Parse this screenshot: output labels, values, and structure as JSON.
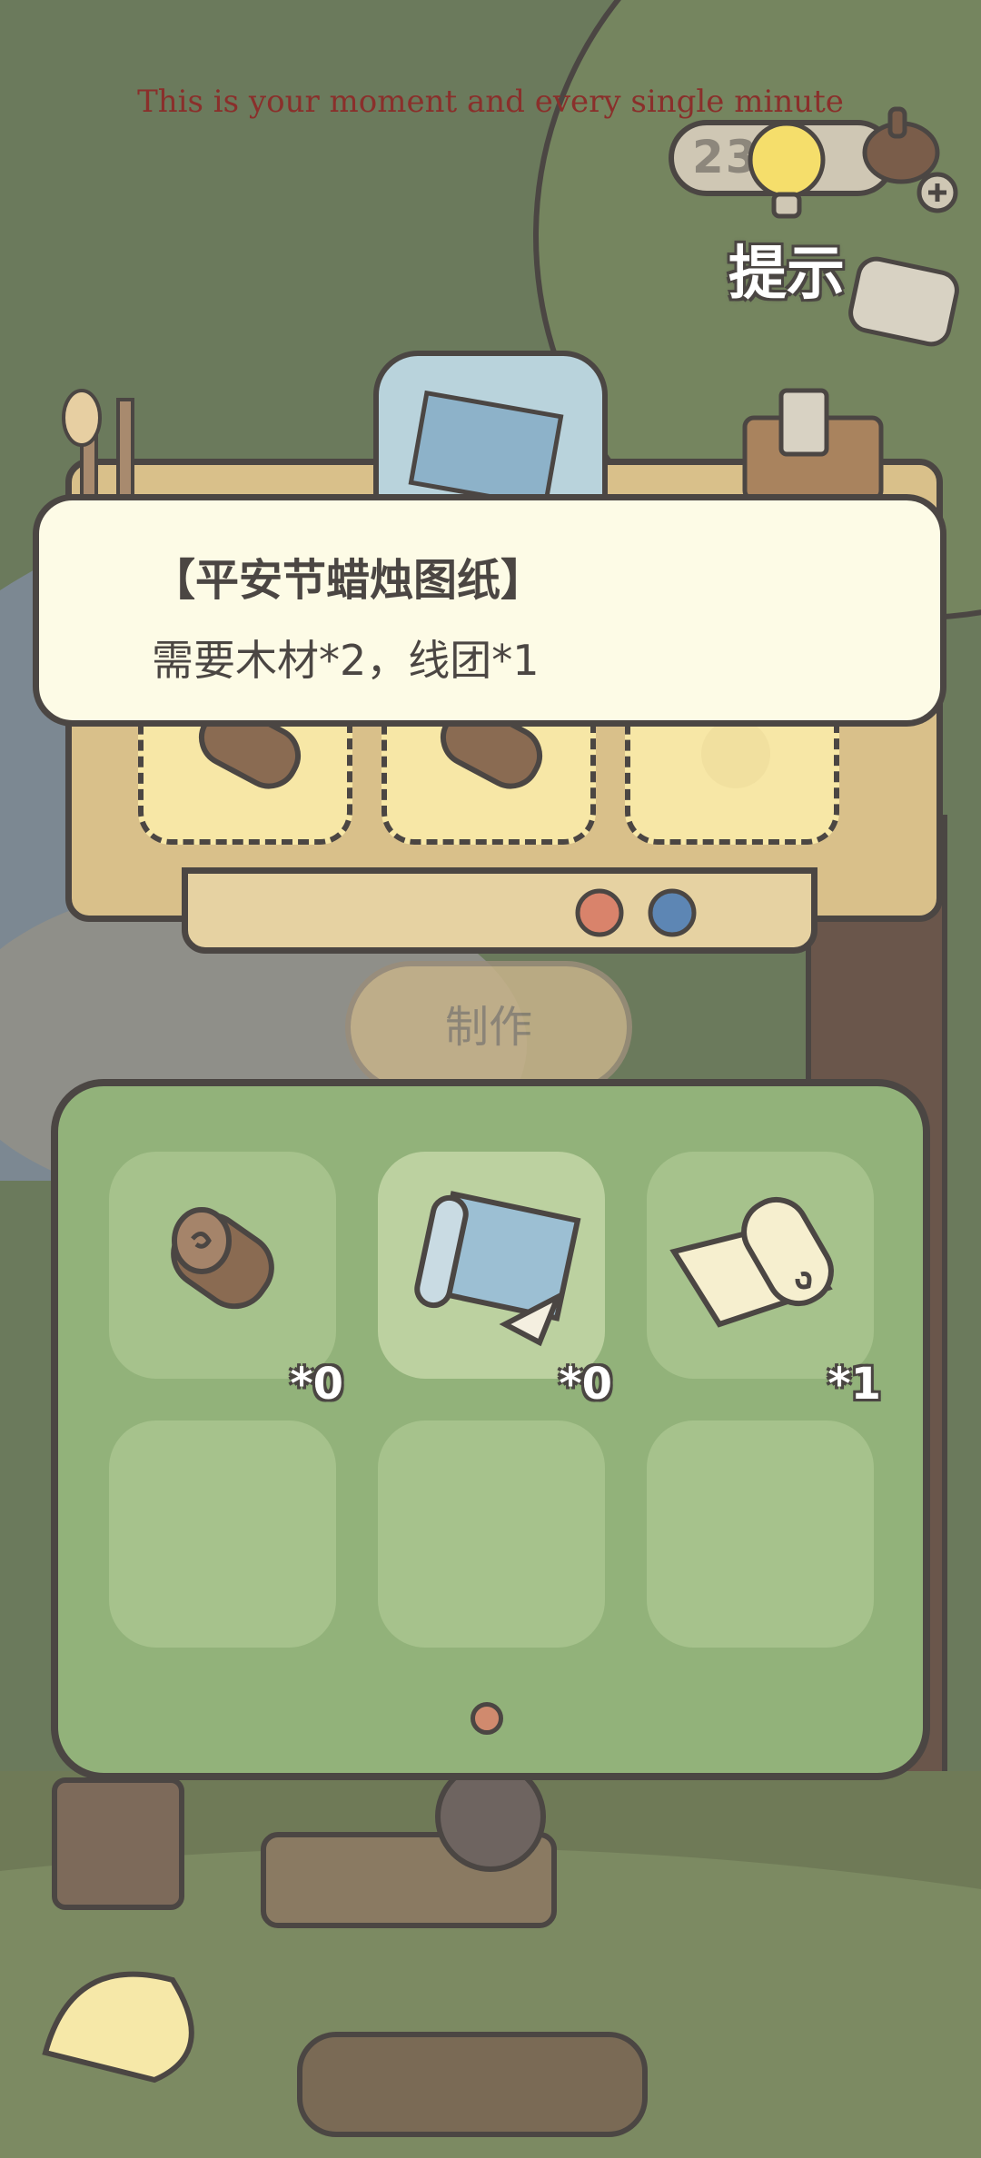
{
  "motto": "This is your moment and every single minute",
  "counter": {
    "value": "23 3"
  },
  "hint": {
    "label": "提示"
  },
  "recipe": {
    "title": "【平安节蜡烛图纸】",
    "requirement": "需要木材*2，线团*1"
  },
  "make_button": {
    "label": "制作"
  },
  "inventory": {
    "items": [
      {
        "name": "wood-log",
        "qty": "*0",
        "selected": false
      },
      {
        "name": "candle-blueprint",
        "qty": "*0",
        "selected": true
      },
      {
        "name": "paper-scroll",
        "qty": "*1",
        "selected": false
      },
      {
        "name": "",
        "qty": "",
        "selected": false
      },
      {
        "name": "",
        "qty": "",
        "selected": false
      },
      {
        "name": "",
        "qty": "",
        "selected": false
      }
    ],
    "page": 1
  },
  "colors": {
    "outline": "#4b4643",
    "panel_green": "#92b27a",
    "card_cream": "#fdfbe6",
    "bench_wood": "#d9c08a",
    "motto_red": "#8a2f2b"
  }
}
